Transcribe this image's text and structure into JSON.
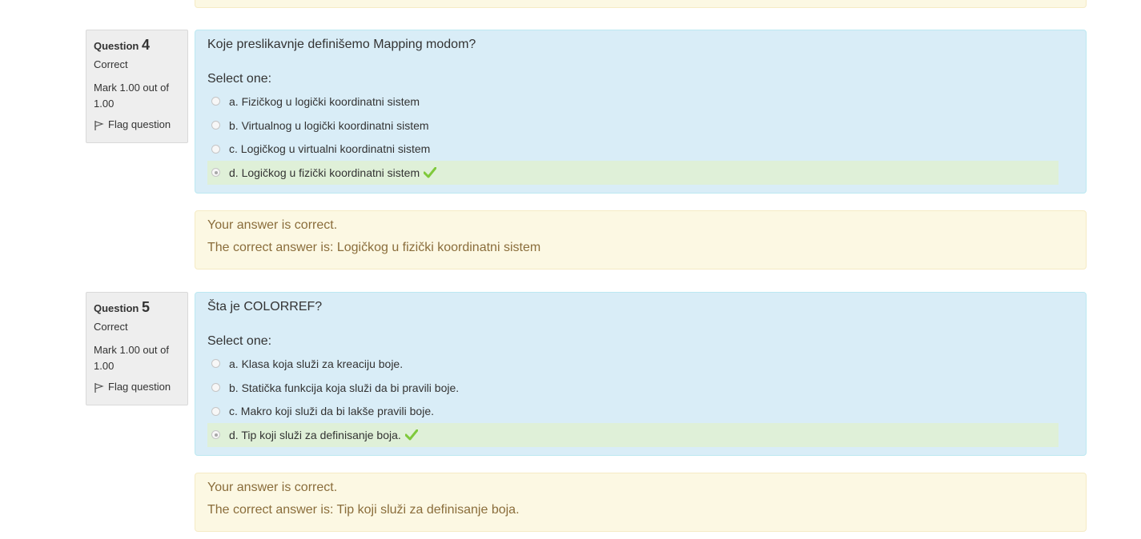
{
  "questions": [
    {
      "label": "Question",
      "number": "4",
      "state": "Correct",
      "mark": "Mark 1.00 out of 1.00",
      "flag": "Flag question",
      "text": "Koje preslikavnje definišemo Mapping modom?",
      "prompt": "Select one:",
      "answers": [
        "a. Fizičkog u logički koordinatni sistem",
        "b. Virtualnog u logički koordinatni sistem",
        "c. Logičkog u virtualni koordinatni sistem",
        "d. Logičkog u fizički koordinatni sistem"
      ],
      "selected_index": 3,
      "feedback": "Your answer is correct.",
      "right_answer": "The correct answer is: Logičkog u fizički koordinatni sistem"
    },
    {
      "label": "Question",
      "number": "5",
      "state": "Correct",
      "mark": "Mark 1.00 out of 1.00",
      "flag": "Flag question",
      "text": "Šta je COLORREF?",
      "prompt": "Select one:",
      "answers": [
        "a. Klasa koja služi za kreaciju boje.",
        "b. Statička funkcija koja služi da bi pravili boje.",
        "c. Makro koji služi da bi lakše pravili boje.",
        "d. Tip koji služi za definisanje boja."
      ],
      "selected_index": 3,
      "feedback": "Your answer is correct.",
      "right_answer": "The correct answer is: Tip koji služi za definisanje boja."
    }
  ],
  "colors": {
    "info_bg": "#eeeeee",
    "formulation_bg": "#d9edf7",
    "correct_bg": "#dff0d8",
    "feedback_bg": "#fcf8e3",
    "feedback_text": "#8a6d3b",
    "check_green": "#7fc93b"
  },
  "icons": {
    "flag": "flag-icon",
    "check": "check-icon"
  }
}
